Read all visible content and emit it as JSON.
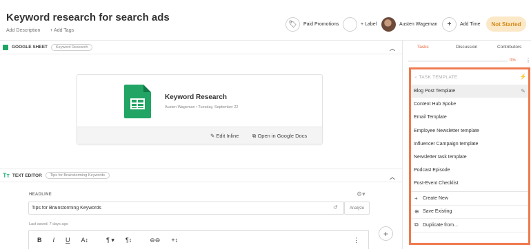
{
  "header": {
    "title": "Keyword research for search ads",
    "add_description": "Add Description",
    "add_tags": "+ Add Tags",
    "paid_promotions": "Paid Promotions",
    "label": "+ Label",
    "assignee": "Austen Wageman",
    "add_time": "Add Time",
    "status": "Not Started"
  },
  "google_sheet": {
    "section_title": "GOOGLE SHEET",
    "tag": "Keyword Research",
    "doc_title": "Keyword Research",
    "doc_meta": "Austen Wageman • Tuesday, September 22",
    "edit_inline": "Edit Inline",
    "open_in_docs": "Open in Google Docs"
  },
  "text_editor": {
    "section_title": "TEXT EDITOR",
    "tag": "Tips for Brainstorming Keywords",
    "headline_label": "HEADLINE",
    "headline_value": "Tips for Brainstorming Keywords",
    "analyze": "Analyze",
    "last_saved": "Last saved: 7 days ago",
    "toolbar": [
      "B",
      "I",
      "U",
      "A↕",
      "¶ ▾",
      "¶↕",
      "⊖⊖",
      "+↕",
      "⋮"
    ]
  },
  "sidebar": {
    "tabs": [
      "Tasks",
      "Discussion",
      "Contributors"
    ],
    "active_tab": "Tasks",
    "progress_pct": "0%",
    "progress_value": 0,
    "popover": {
      "title": "TASK TEMPLATE",
      "templates": [
        "Blog Post Template",
        "Content Hub Spoke",
        "Email Template",
        "Employee Newsletter template",
        "Influencer Campaign template",
        "Newsletter task template",
        "Podcast Episode",
        "Post-Event Checklist"
      ],
      "selected_index": 0,
      "actions": [
        "Create New",
        "Save Existing",
        "Duplicate from..."
      ]
    }
  },
  "colors": {
    "accent": "#ef7a4e",
    "status_bg": "#fbe8c7",
    "status_text": "#d38a1a",
    "sheets_green": "#21a464"
  }
}
